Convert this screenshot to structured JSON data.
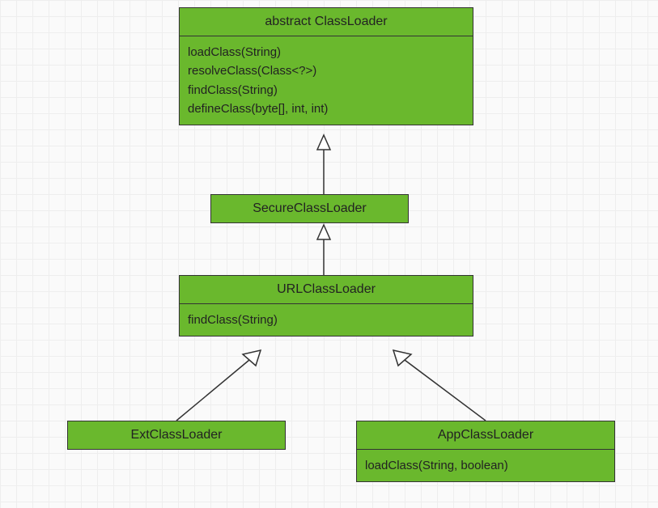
{
  "classes": {
    "classloader": {
      "title": "abstract ClassLoader",
      "methods": [
        "loadClass(String)",
        "resolveClass(Class<?>)",
        "findClass(String)",
        "defineClass(byte[], int, int)"
      ]
    },
    "secure": {
      "title": "SecureClassLoader"
    },
    "url": {
      "title": "URLClassLoader",
      "methods": [
        "findClass(String)"
      ]
    },
    "ext": {
      "title": "ExtClassLoader"
    },
    "app": {
      "title": "AppClassLoader",
      "methods": [
        "loadClass(String, boolean)"
      ]
    }
  }
}
